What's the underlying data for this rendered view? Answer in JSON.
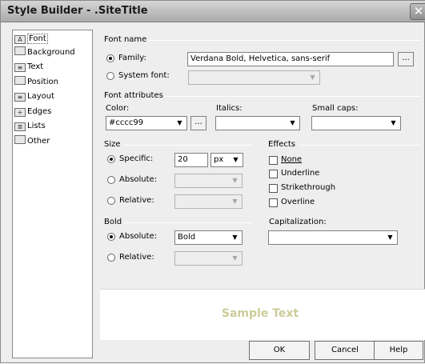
{
  "window": {
    "title": "Style Builder - .SiteTitle",
    "close_glyph": "✕"
  },
  "sidebar": {
    "items": [
      {
        "label": "Font",
        "icon": "font-icon",
        "selected": true
      },
      {
        "label": "Background",
        "icon": "background-icon"
      },
      {
        "label": "Text",
        "icon": "text-icon"
      },
      {
        "label": "Position",
        "icon": "position-icon"
      },
      {
        "label": "Layout",
        "icon": "layout-icon"
      },
      {
        "label": "Edges",
        "icon": "edges-icon"
      },
      {
        "label": "Lists",
        "icon": "lists-icon"
      },
      {
        "label": "Other",
        "icon": "other-icon"
      }
    ]
  },
  "font_name": {
    "group_title": "Font name",
    "family_label": "Family:",
    "family_value": "Verdana Bold, Helvetica, sans-serif",
    "family_selected": true,
    "system_font_label": "System font:",
    "browse_label": "..."
  },
  "font_attributes": {
    "group_title": "Font attributes",
    "color_label": "Color:",
    "color_value": "#cccc99",
    "color_browse_label": "...",
    "italics_label": "Italics:",
    "italics_value": "",
    "small_caps_label": "Small caps:",
    "small_caps_value": ""
  },
  "size": {
    "group_title": "Size",
    "specific_label": "Specific:",
    "specific_value": "20",
    "unit_value": "px",
    "absolute_label": "Absolute:",
    "relative_label": "Relative:",
    "selected": "specific"
  },
  "effects": {
    "group_title": "Effects",
    "items": [
      "None",
      "Underline",
      "Strikethrough",
      "Overline"
    ]
  },
  "bold": {
    "group_title": "Bold",
    "absolute_label": "Absolute:",
    "absolute_value": "Bold",
    "relative_label": "Relative:",
    "selected": "absolute"
  },
  "capitalization": {
    "label": "Capitalization:",
    "value": ""
  },
  "preview": {
    "sample_text": "Sample Text",
    "sample_color": "#cccc99"
  },
  "buttons": {
    "ok": "OK",
    "cancel": "Cancel",
    "help": "Help"
  },
  "colors": {
    "title_bar": "#a9a9a9",
    "dialog_bg": "#eeeeee"
  }
}
